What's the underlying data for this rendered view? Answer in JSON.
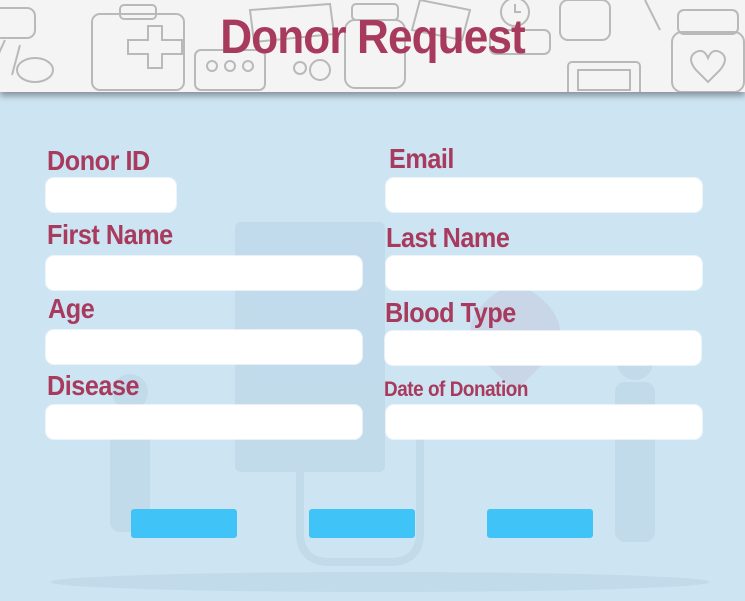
{
  "header": {
    "title": "Donor Request"
  },
  "form": {
    "donor_id": {
      "label": "Donor ID",
      "value": ""
    },
    "email": {
      "label": "Email",
      "value": ""
    },
    "first_name": {
      "label": "First Name",
      "value": ""
    },
    "last_name": {
      "label": "Last Name",
      "value": ""
    },
    "age": {
      "label": "Age",
      "value": ""
    },
    "blood_type": {
      "label": "Blood Type",
      "value": ""
    },
    "disease": {
      "label": "Disease",
      "value": ""
    },
    "date_of_donation": {
      "label": "Date of Donation",
      "value": ""
    }
  },
  "buttons": [
    {
      "label": ""
    },
    {
      "label": ""
    },
    {
      "label": ""
    }
  ],
  "colors": {
    "title": "#a83a5d",
    "label": "#a83a5d",
    "background": "#cde4f2",
    "button": "#40c3f6",
    "input": "#ffffff"
  }
}
